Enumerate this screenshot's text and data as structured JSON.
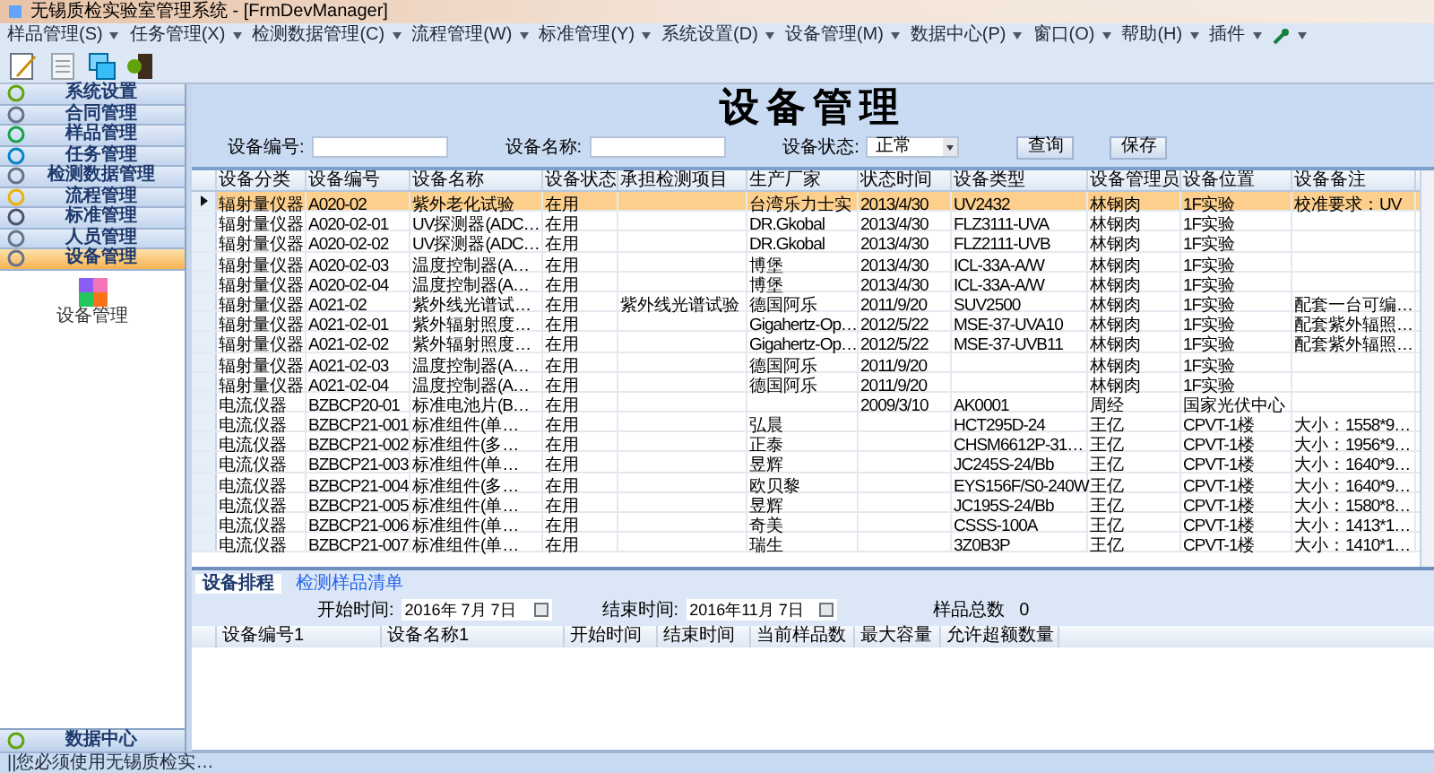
{
  "window": {
    "title": "无锡质检实验室管理系统 - [FrmDevManager]"
  },
  "menu": [
    "样品管理(S)",
    "任务管理(X)",
    "检测数据管理(C)",
    "流程管理(W)",
    "标准管理(Y)",
    "系统设置(D)",
    "设备管理(M)",
    "数据中心(P)",
    "窗口(O)",
    "帮助(H)",
    "插件"
  ],
  "sidebar": {
    "items": [
      {
        "label": "系统设置",
        "selected": false
      },
      {
        "label": "合同管理",
        "selected": false
      },
      {
        "label": "样品管理",
        "selected": false
      },
      {
        "label": "任务管理",
        "selected": false
      },
      {
        "label": "检测数据管理",
        "selected": false
      },
      {
        "label": "流程管理",
        "selected": false
      },
      {
        "label": "标准管理",
        "selected": false
      },
      {
        "label": "人员管理",
        "selected": false
      },
      {
        "label": "设备管理",
        "selected": true
      }
    ],
    "entry": "设备管理",
    "footer": "数据中心"
  },
  "heading": "设备管理",
  "form": {
    "code_label": "设备编号:",
    "name_label": "设备名称:",
    "status_label": "设备状态:",
    "status_value": "正常",
    "buttons": [
      "查询",
      "保存"
    ]
  },
  "table": {
    "columns": [
      "设备分类",
      "设备编号",
      "设备名称",
      "设备状态",
      "承担检测项目",
      "生产厂家",
      "状态时间",
      "设备类型",
      "设备管理员",
      "设备位置",
      "设备备注"
    ],
    "rows": [
      {
        "selected": true,
        "cells": [
          "辐射量仪器",
          "A020-02",
          "紫外老化试验",
          "在用",
          "",
          "台湾乐力士实",
          "2013/4/30",
          "UV2432",
          "林钢肉",
          "1F实验",
          "校准要求：UV"
        ]
      },
      {
        "selected": false,
        "cells": [
          "辐射量仪器",
          "A020-02-01",
          "UV探测器(ADC…",
          "在用",
          "",
          "DR.Gkobal",
          "2013/4/30",
          "FLZ3111-UVA",
          "林钢肉",
          "1F实验",
          ""
        ]
      },
      {
        "selected": false,
        "cells": [
          "辐射量仪器",
          "A020-02-02",
          "UV探测器(ADC…",
          "在用",
          "",
          "DR.Gkobal",
          "2013/4/30",
          "FLZ2111-UVB",
          "林钢肉",
          "1F实验",
          ""
        ]
      },
      {
        "selected": false,
        "cells": [
          "辐射量仪器",
          "A020-02-03",
          "温度控制器(A…",
          "在用",
          "",
          "博堡",
          "2013/4/30",
          "ICL-33A-A/W",
          "林钢肉",
          "1F实验",
          ""
        ]
      },
      {
        "selected": false,
        "cells": [
          "辐射量仪器",
          "A020-02-04",
          "温度控制器(A…",
          "在用",
          "",
          "博堡",
          "2013/4/30",
          "ICL-33A-A/W",
          "林钢肉",
          "1F实验",
          ""
        ]
      },
      {
        "selected": false,
        "cells": [
          "辐射量仪器",
          "A021-02",
          "紫外线光谱试…",
          "在用",
          "紫外线光谱试验",
          "德国阿乐",
          "2011/9/20",
          "SUV2500",
          "林钢肉",
          "1F实验",
          "配套一台可编…"
        ]
      },
      {
        "selected": false,
        "cells": [
          "辐射量仪器",
          "A021-02-01",
          "紫外辐射照度…",
          "在用",
          "",
          "Gigahertz-Op…",
          "2012/5/22",
          "MSE-37-UVA10",
          "林钢肉",
          "1F实验",
          "配套紫外辐照…"
        ]
      },
      {
        "selected": false,
        "cells": [
          "辐射量仪器",
          "A021-02-02",
          "紫外辐射照度…",
          "在用",
          "",
          "Gigahertz-Op…",
          "2012/5/22",
          "MSE-37-UVB11",
          "林钢肉",
          "1F实验",
          "配套紫外辐照…"
        ]
      },
      {
        "selected": false,
        "cells": [
          "辐射量仪器",
          "A021-02-03",
          "温度控制器(A…",
          "在用",
          "",
          "德国阿乐",
          "2011/9/20",
          "",
          "林钢肉",
          "1F实验",
          ""
        ]
      },
      {
        "selected": false,
        "cells": [
          "辐射量仪器",
          "A021-02-04",
          "温度控制器(A…",
          "在用",
          "",
          "德国阿乐",
          "2011/9/20",
          "",
          "林钢肉",
          "1F实验",
          ""
        ]
      },
      {
        "selected": false,
        "cells": [
          "电流仪器",
          "BZBCP20-01",
          "标准电池片(B…",
          "在用",
          "",
          "",
          "2009/3/10",
          "AK0001",
          "周经",
          "国家光伏中心",
          ""
        ]
      },
      {
        "selected": false,
        "cells": [
          "电流仪器",
          "BZBCP21-001",
          "标准组件(单…",
          "在用",
          "",
          "弘晨",
          "",
          "HCT295D-24",
          "王亿",
          "CPVT-1楼",
          "大小：1558*9…"
        ]
      },
      {
        "selected": false,
        "cells": [
          "电流仪器",
          "BZBCP21-002",
          "标准组件(多…",
          "在用",
          "",
          "正泰",
          "",
          "CHSM6612P-31…",
          "王亿",
          "CPVT-1楼",
          "大小：1956*9…"
        ]
      },
      {
        "selected": false,
        "cells": [
          "电流仪器",
          "BZBCP21-003",
          "标准组件(单…",
          "在用",
          "",
          "昱辉",
          "",
          "JC245S-24/Bb",
          "王亿",
          "CPVT-1楼",
          "大小：1640*9…"
        ]
      },
      {
        "selected": false,
        "cells": [
          "电流仪器",
          "BZBCP21-004",
          "标准组件(多…",
          "在用",
          "",
          "欧贝黎",
          "",
          "EYS156F/S0-240W",
          "王亿",
          "CPVT-1楼",
          "大小：1640*9…"
        ]
      },
      {
        "selected": false,
        "cells": [
          "电流仪器",
          "BZBCP21-005",
          "标准组件(单…",
          "在用",
          "",
          "昱辉",
          "",
          "JC195S-24/Bb",
          "王亿",
          "CPVT-1楼",
          "大小：1580*8…"
        ]
      },
      {
        "selected": false,
        "cells": [
          "电流仪器",
          "BZBCP21-006",
          "标准组件(单…",
          "在用",
          "",
          "奇美",
          "",
          "CSSS-100A",
          "王亿",
          "CPVT-1楼",
          "大小：1413*1…"
        ]
      },
      {
        "selected": false,
        "cells": [
          "电流仪器",
          "BZBCP21-007",
          "标准组件(单…",
          "在用",
          "",
          "瑞生",
          "",
          "3Z0B3P",
          "王亿",
          "CPVT-1楼",
          "大小：1410*1…"
        ]
      }
    ]
  },
  "bottom": {
    "tabs": [
      {
        "label": "设备排程",
        "selected": true
      },
      {
        "label": "检测样品清单",
        "selected": false
      }
    ],
    "start_label": "开始时间:",
    "start_value": "2016年 7月 7日",
    "end_label": "结束时间:",
    "end_value": "2016年11月 7日",
    "total_label": "样品总数",
    "total_value": "0",
    "columns": [
      "设备编号1",
      "设备名称1",
      "开始时间",
      "结束时间",
      "当前样品数",
      "最大容量",
      "允许超额数量"
    ]
  },
  "status_bar": "||您必须使用无锡质检实…"
}
